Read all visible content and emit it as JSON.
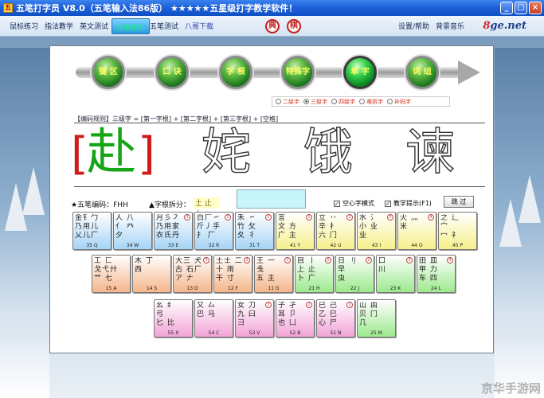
{
  "window": {
    "title": "五笔打字员 V8.0（五笔输入法86版） ★★★★★五星级打字教学软件！",
    "buttons": [
      "_",
      "□",
      "×"
    ]
  },
  "nav": {
    "items": [
      "鼠标练习",
      "指法教学",
      "英文测试",
      "五笔练习",
      "五笔测试",
      "八哥下载"
    ],
    "active": "五笔练习",
    "seals": [
      "典",
      "棋"
    ],
    "right_items": [
      "设置/帮助",
      "背景音乐"
    ],
    "logo_num": "8",
    "logo_text": "ge.net"
  },
  "orbs": [
    "键 区",
    "口 诀",
    "字 根",
    "特殊字",
    "单 字",
    "词 组"
  ],
  "levels": {
    "options": [
      "二级字",
      "三级字",
      "四级字",
      "难拆字",
      "补码字"
    ],
    "selected": "三级字"
  },
  "rule_text": "【编码规则】三级字 = [第一字根] + [第二字根] + [第三字根] + [空格]",
  "practice": {
    "current_char": "赴",
    "upcoming": [
      "姹",
      "饿",
      "谏"
    ]
  },
  "status": {
    "code_label": "★五笔编码：FHH",
    "roots_label": "▲字根拆分：",
    "roots_value": "土 止 卜",
    "hollow_mode": "空心字模式",
    "hint": "教学提示(F1)",
    "skip": "跳 过"
  },
  "keys_row1": [
    {
      "code": "35 Q",
      "num": "",
      "color": "blue",
      "g": "金钅勹\n乃用儿\n乂儿厂"
    },
    {
      "code": "34 W",
      "num": "",
      "color": "blue",
      "g": "人 八\n亻 癶\n  夕"
    },
    {
      "code": "33 E",
      "num": "3",
      "color": "blue",
      "g": "月彡㇇\n乃用家\n衣氏丹"
    },
    {
      "code": "32 R",
      "num": "2",
      "color": "blue",
      "g": "白厂㇀\n斤丿手\n扌 厂"
    },
    {
      "code": "31 T",
      "num": "1",
      "color": "blue",
      "g": "禾 ㇀\n竹 攵\n夂 彳"
    },
    {
      "code": "41 Y",
      "num": "1",
      "color": "yellow",
      "g": "言 \n文 方\n广 主"
    },
    {
      "code": "42 U",
      "num": "2",
      "color": "yellow",
      "g": "立 丷\n辛 扌\n六 门"
    },
    {
      "code": "43 I",
      "num": "3",
      "color": "yellow",
      "g": "水 氵\n小 业\n 业"
    },
    {
      "code": "44 O",
      "num": "4",
      "color": "yellow",
      "g": "火 灬\n 米"
    },
    {
      "code": "45 P",
      "num": "",
      "color": "yellow",
      "g": "之 辶\n 宀\n冖 礻"
    }
  ],
  "keys_row2": [
    {
      "code": "15 A",
      "num": "",
      "color": "orange",
      "g": "工 匚\n戈弋廾\n艹 七"
    },
    {
      "code": "14 S",
      "num": "",
      "color": "orange",
      "g": "木 丁\n西 "
    },
    {
      "code": "13 D",
      "num": "3",
      "color": "orange",
      "g": "大三 犬\n古 石厂\n ア 𠂇"
    },
    {
      "code": "12 F",
      "num": "2",
      "color": "orange",
      "g": "土士 二\n十 雨\n 干 寸"
    },
    {
      "code": "11 G",
      "num": "1",
      "color": "orange",
      "g": "王 一\n 戋\n五 主"
    },
    {
      "code": "21 H",
      "num": "1",
      "color": "green",
      "g": "目 丨\n上 止\n卜 广"
    },
    {
      "code": "22 J",
      "num": "2",
      "color": "green",
      "g": "日 刂\n早 \n 虫"
    },
    {
      "code": "23 K",
      "num": "3",
      "color": "green",
      "g": "口 \n川 "
    },
    {
      "code": "24 L",
      "num": "4",
      "color": "green",
      "g": "田 皿\n甲 力\n车 四"
    }
  ],
  "keys_row3": [
    {
      "code": "55 X",
      "num": "",
      "color": "pink",
      "g": "幺 纟\n弓 \n匕 比"
    },
    {
      "code": "54 C",
      "num": "",
      "color": "pink",
      "g": "又 厶\n巴 马\n "
    },
    {
      "code": "53 V",
      "num": "3",
      "color": "pink",
      "g": "女 刀\n九 臼\n 彐"
    },
    {
      "code": "52 B",
      "num": "2",
      "color": "pink",
      "g": "子 孑\n耳 卩\n也 凵"
    },
    {
      "code": "51 N",
      "num": "1",
      "color": "pink",
      "g": "已 己\n乙 巳\n心 尸"
    },
    {
      "code": "25 M",
      "num": "",
      "color": "green",
      "g": "山 由\n贝 冂\n几 "
    }
  ],
  "watermark": "京华手游网"
}
